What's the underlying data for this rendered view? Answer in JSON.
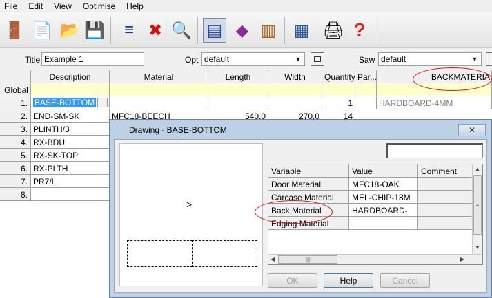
{
  "menu": [
    "File",
    "Edit",
    "View",
    "Optimise",
    "Help"
  ],
  "toolbar_icons": [
    {
      "name": "exit-icon",
      "glyph": "🚪"
    },
    {
      "name": "new-icon",
      "glyph": "📄"
    },
    {
      "name": "open-icon",
      "glyph": "📂"
    },
    {
      "name": "save-icon",
      "glyph": "💾"
    },
    {
      "name": "insert-row-icon",
      "glyph": "≡"
    },
    {
      "name": "delete-icon",
      "glyph": "✖"
    },
    {
      "name": "find-icon",
      "glyph": "🔍"
    },
    {
      "name": "parts-list-icon",
      "glyph": "▤"
    },
    {
      "name": "materials-icon",
      "glyph": "◆"
    },
    {
      "name": "edging-icon",
      "glyph": "▥"
    },
    {
      "name": "calculator-icon",
      "glyph": "▦"
    },
    {
      "name": "print-icon",
      "glyph": "🖨"
    },
    {
      "name": "help-icon",
      "glyph": "?"
    }
  ],
  "fields": {
    "title_label": "Title",
    "title_value": "Example 1",
    "opt_label": "Opt",
    "opt_value": "default",
    "saw_label": "Saw",
    "saw_value": "default"
  },
  "grid": {
    "headers": [
      "Description",
      "Material",
      "Length",
      "Width",
      "Quantity",
      "Par...",
      "BACKMATERIA"
    ],
    "global_label": "Global",
    "rows": [
      {
        "num": "1.",
        "desc": "BASE-BOTTOM",
        "material": "",
        "length": "",
        "width": "",
        "qty": "1",
        "backmat": "HARDBOARD-4MM"
      },
      {
        "num": "2.",
        "desc": "END-SM-SK",
        "material": "MFC18-BEECH",
        "length": "540.0",
        "width": "270.0",
        "qty": "14",
        "backmat": ""
      },
      {
        "num": "3.",
        "desc": "PLINTH/3",
        "material": "",
        "length": "",
        "width": "",
        "qty": "",
        "backmat": ""
      },
      {
        "num": "4.",
        "desc": "RX-BDU",
        "material": "",
        "length": "",
        "width": "",
        "qty": "",
        "backmat": ""
      },
      {
        "num": "5.",
        "desc": "RX-SK-TOP",
        "material": "",
        "length": "",
        "width": "",
        "qty": "",
        "backmat": ""
      },
      {
        "num": "6.",
        "desc": "RX-PLTH",
        "material": "",
        "length": "",
        "width": "",
        "qty": "",
        "backmat": ""
      },
      {
        "num": "7.",
        "desc": "PR7/L",
        "material": "",
        "length": "",
        "width": "",
        "qty": "",
        "backmat": ""
      },
      {
        "num": "8.",
        "desc": "",
        "material": "",
        "length": "",
        "width": "",
        "qty": "",
        "backmat": ""
      }
    ]
  },
  "dialog": {
    "title": "Drawing - BASE-BOTTOM",
    "close_glyph": "✕",
    "drawing_glyph": ">",
    "var_headers": [
      "Variable",
      "Value",
      "Comment"
    ],
    "vars": [
      {
        "variable": "Door Material",
        "value": "MFC18-OAK",
        "comment": ""
      },
      {
        "variable": "Carcase Material",
        "value": "MEL-CHIP-18M",
        "comment": ""
      },
      {
        "variable": "Back Material",
        "value": "HARDBOARD-",
        "comment": ""
      },
      {
        "variable": "Edging Material",
        "value": "",
        "comment": ""
      }
    ],
    "ok_label": "OK",
    "help_label": "Help",
    "cancel_label": "Cancel"
  },
  "colors": {
    "annotation": "#e01010",
    "selection": "#3399ff",
    "global_row": "#ffffcc"
  }
}
